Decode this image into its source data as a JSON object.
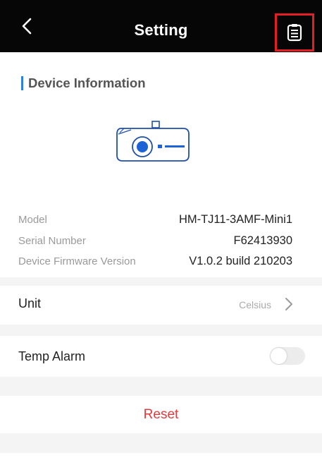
{
  "header": {
    "title": "Setting",
    "back_icon": "chevron-left-icon",
    "doc_icon": "document-icon",
    "highlight_color": "#e31e24"
  },
  "device_info": {
    "section_title": "Device Information",
    "accent_color": "#2f7fe0",
    "rows": [
      {
        "label": "Model",
        "value": "HM-TJ11-3AMF-Mini1"
      },
      {
        "label": "Serial Number",
        "value": "F62413930"
      },
      {
        "label": "Device Firmware Version",
        "value": "V1.0.2 build 210203"
      }
    ]
  },
  "settings": {
    "unit": {
      "label": "Unit",
      "value": "Celsius"
    },
    "temp_alarm": {
      "label": "Temp Alarm",
      "enabled": false
    }
  },
  "reset": {
    "label": "Reset",
    "color": "#e4393c"
  }
}
